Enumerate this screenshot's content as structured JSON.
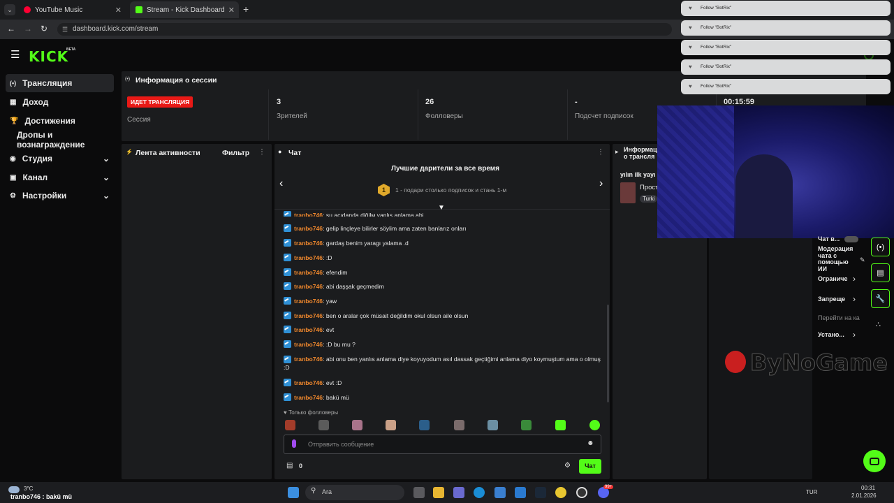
{
  "browser": {
    "tabs": [
      {
        "label": "YouTube Music",
        "active": false
      },
      {
        "label": "Stream - Kick Dashboard",
        "active": true
      }
    ],
    "url": "dashboard.kick.com/stream"
  },
  "header": {
    "logo": "KICK",
    "beta": "BETA"
  },
  "sidebar": {
    "items": [
      {
        "label": "Трансляция",
        "icon": "broadcast-icon",
        "active": true
      },
      {
        "label": "Доход",
        "icon": "chart-icon"
      },
      {
        "label": "Достижения",
        "icon": "trophy-icon"
      },
      {
        "label": "Дропы и вознаграждение",
        "icon": ""
      },
      {
        "label": "Студия",
        "icon": "studio-icon",
        "expandable": true
      },
      {
        "label": "Канал",
        "icon": "channel-icon",
        "expandable": true
      },
      {
        "label": "Настройки",
        "icon": "gear-icon",
        "expandable": true
      }
    ]
  },
  "session": {
    "title": "Информация о сессии",
    "live_badge": "ИДЕТ ТРАНСЛЯЦИЯ",
    "session_label": "Сессия",
    "viewers_value": "3",
    "viewers_label": "Зрителей",
    "followers_value": "26",
    "followers_label": "Фолловеры",
    "subs_value": "-",
    "subs_label": "Подсчет подписок",
    "timer": "00:15:59"
  },
  "activity": {
    "title": "Лента активности",
    "filter": "Фильтр"
  },
  "chat": {
    "title": "Чат",
    "top_gifters_title": "Лучшие дарители за все время",
    "rank": "1",
    "top_gifters_text": "1 - подари столько подписок и стань 1-м",
    "messages": [
      {
        "user": "tranbo746",
        "text": ": şu açıdandа diğilм yanlış anlama abi"
      },
      {
        "user": "tranbo746",
        "text": ": gelip linçleye bilirler söylim ama zaten banlarız onları"
      },
      {
        "user": "tranbo746",
        "text": ": gardaş benim yaragı yalama .d"
      },
      {
        "user": "tranbo746",
        "text": ": :D"
      },
      {
        "user": "tranbo746",
        "text": ": efendim"
      },
      {
        "user": "tranbo746",
        "text": ": abi daşşak geçmedim"
      },
      {
        "user": "tranbo746",
        "text": ": yaw"
      },
      {
        "user": "tranbo746",
        "text": ": ben o aralar çok müsait değildim okul olsun aile olsun"
      },
      {
        "user": "tranbo746",
        "text": ": evt"
      },
      {
        "user": "tranbo746",
        "text": ": :D bu mu ?"
      },
      {
        "user": "tranbo746",
        "text": ": abi onu ben yanlıs anlama diye koyuyodum asıl dassak geçtiğimi anlama diyo koymuştum ama o olmuş :D"
      },
      {
        "user": "tranbo746",
        "text": ": evt :D"
      },
      {
        "user": "tranbo746",
        "text": ": bakü mü"
      }
    ],
    "followers_only": "Только фолловеры",
    "input_placeholder": "Отправить сообщение",
    "points": "0",
    "send_button": "Чат"
  },
  "info_panel": {
    "title_line1": "Информац",
    "title_line2": "о трансля",
    "stream_title": "yılın ilk yayı",
    "category": "Прост",
    "tag": "Turki"
  },
  "moderation": {
    "chat_toggle": "Чат в...",
    "ai_mod": "Модерация чата с помощью ИИ",
    "restricted": "Ограниче",
    "banned": "Запреще",
    "goto": "Перейти на ка",
    "settings": "Устано..."
  },
  "notifications": [
    "Follow \"BotRix\"",
    "Follow \"BotRix\"",
    "Follow \"BotRix\"",
    "Follow \"BotRix\"",
    "Follow \"BotRix\""
  ],
  "watermark": "ByNoGame",
  "taskbar": {
    "weather": "3°C",
    "ticker": "tranbo746 : bakü mü",
    "search": "Ara",
    "lang": "TUR",
    "time": "00:31",
    "date": "2.01.2026",
    "badge": "99+"
  },
  "colors": {
    "accent": "#53fc18",
    "live": "#e91916",
    "username": "#f0882d",
    "panel": "#1b1c1e"
  }
}
